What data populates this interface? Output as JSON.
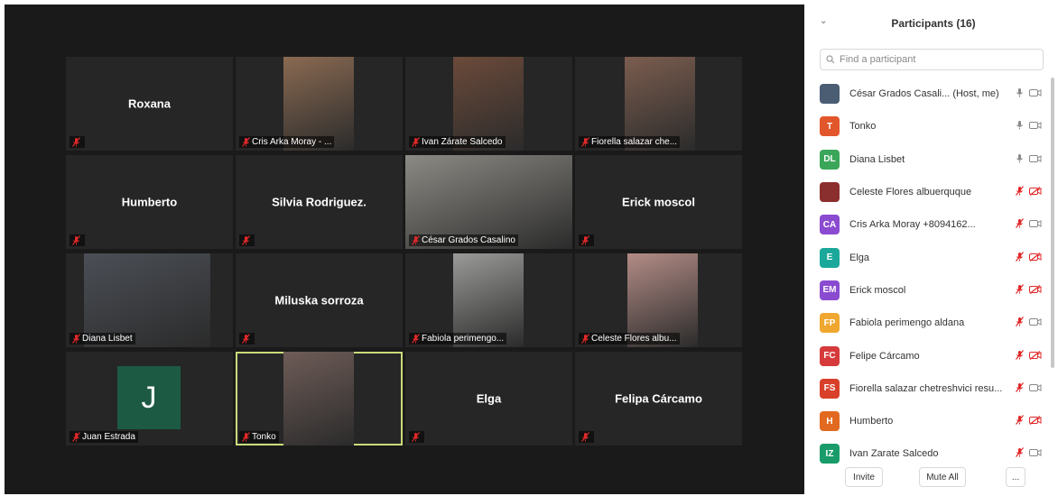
{
  "colors": {
    "bg": "#1a1a1a",
    "tile": "#262626",
    "active_border": "#c9dc7a",
    "mic_off": "#e02828"
  },
  "tiles": [
    {
      "name": "Roxana",
      "label": ""
    },
    {
      "name": "",
      "label": "Cris Arka Moray - ..."
    },
    {
      "name": "",
      "label": "Ivan Zárate Salcedo"
    },
    {
      "name": "",
      "label": "Fiorella salazar che..."
    },
    {
      "name": "Humberto",
      "label": ""
    },
    {
      "name": "Silvia Rodriguez.",
      "label": ""
    },
    {
      "name": "",
      "label": "César Grados Casalino"
    },
    {
      "name": "Erick moscol",
      "label": ""
    },
    {
      "name": "",
      "label": "Diana Lisbet"
    },
    {
      "name": "Miluska sorroza",
      "label": ""
    },
    {
      "name": "",
      "label": "Fabiola perimengo..."
    },
    {
      "name": "",
      "label": "Celeste Flores albu..."
    },
    {
      "name": "",
      "label": "Juan Estrada",
      "avatar": "J"
    },
    {
      "name": "",
      "label": "Tonko"
    },
    {
      "name": "Elga",
      "label": ""
    },
    {
      "name": "Felipa Cárcamo",
      "label": ""
    }
  ],
  "panel": {
    "title": "Participants (16)",
    "search_placeholder": "Find a participant",
    "participants": [
      {
        "initials": "",
        "name": "César Grados Casali... (Host, me)",
        "color": "#4a5d73",
        "mic": "on",
        "video": "on"
      },
      {
        "initials": "T",
        "name": "Tonko",
        "color": "#e2562b",
        "mic": "on",
        "video": "on"
      },
      {
        "initials": "DL",
        "name": "Diana Lisbet",
        "color": "#3aa65a",
        "mic": "on",
        "video": "on"
      },
      {
        "initials": "",
        "name": "Celeste Flores albuerquque",
        "color": "#8b2e2e",
        "mic": "off",
        "video": "off"
      },
      {
        "initials": "CA",
        "name": "Cris Arka Moray +8094162...",
        "color": "#8a4bd0",
        "mic": "off",
        "video": "on"
      },
      {
        "initials": "E",
        "name": "Elga",
        "color": "#1ba89a",
        "mic": "off",
        "video": "off"
      },
      {
        "initials": "EM",
        "name": "Erick moscol",
        "color": "#8a4bd0",
        "mic": "off",
        "video": "off"
      },
      {
        "initials": "FP",
        "name": "Fabiola perimengo aldana",
        "color": "#f0a72f",
        "mic": "off",
        "video": "on"
      },
      {
        "initials": "FC",
        "name": "Felipe Cárcamo",
        "color": "#d63a3a",
        "mic": "off",
        "video": "off"
      },
      {
        "initials": "FS",
        "name": "Fiorella salazar chetreshvici resu...",
        "color": "#d8402a",
        "mic": "off",
        "video": "on"
      },
      {
        "initials": "H",
        "name": "Humberto",
        "color": "#e26a20",
        "mic": "off",
        "video": "off"
      },
      {
        "initials": "IZ",
        "name": "Ivan Zarate Salcedo",
        "color": "#1a9c6a",
        "mic": "off",
        "video": "on"
      }
    ],
    "invite_label": "Invite",
    "mute_all_label": "Mute All",
    "more_label": "..."
  }
}
